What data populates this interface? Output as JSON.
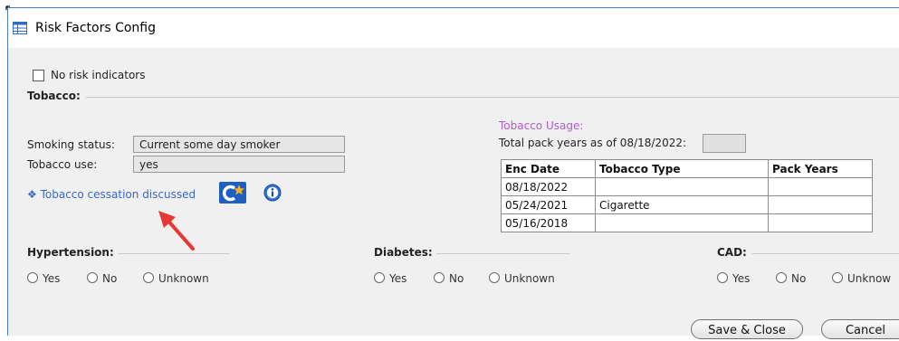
{
  "window": {
    "title": "Risk Factors Config"
  },
  "no_risk": {
    "label": "No risk indicators",
    "checked": false
  },
  "tobacco": {
    "section_label": "Tobacco:",
    "smoking_status_label": "Smoking status:",
    "smoking_status_value": "Current some day smoker",
    "tobacco_use_label": "Tobacco use:",
    "tobacco_use_value": "yes",
    "cessation_link": "Tobacco cessation discussed",
    "cessation_bullet": "❖",
    "usage": {
      "heading": "Tobacco Usage:",
      "total_pack_years_label": "Total pack years as of 08/18/2022:",
      "total_pack_years_value": "",
      "columns": [
        "Enc Date",
        "Tobacco Type",
        "Pack Years"
      ],
      "rows": [
        [
          "08/18/2022",
          "",
          ""
        ],
        [
          "05/24/2021",
          "Cigarette",
          ""
        ],
        [
          "05/16/2018",
          "",
          ""
        ]
      ]
    }
  },
  "conditions": [
    {
      "label": "Hypertension:",
      "options": [
        "Yes",
        "No",
        "Unknown"
      ],
      "selected": null
    },
    {
      "label": "Diabetes:",
      "options": [
        "Yes",
        "No",
        "Unknown"
      ],
      "selected": null
    },
    {
      "label": "CAD:",
      "options": [
        "Yes",
        "No",
        "Unknow"
      ],
      "selected": null
    }
  ],
  "buttons": {
    "save_close": "Save & Close",
    "cancel": "Cancel"
  },
  "colors": {
    "link": "#3a67c4",
    "usage_heading": "#b05cc8",
    "annotation_arrow": "#e53935",
    "icon_blue": "#1f5fbf",
    "badge_orange": "#f5b31d"
  }
}
